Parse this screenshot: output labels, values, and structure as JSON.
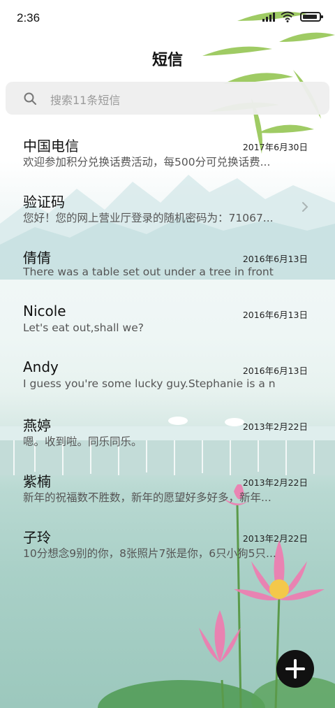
{
  "status_bar": {
    "time": "2:36"
  },
  "header": {
    "title": "短信"
  },
  "search": {
    "placeholder": "搜索11条短信"
  },
  "messages": [
    {
      "name": "中国电信",
      "date": "2017年6月30日",
      "preview": "欢迎参加积分兑换话费活动，每500分可兑换话费...",
      "chevron": false
    },
    {
      "name": "验证码",
      "date": "",
      "preview": "您好！您的网上营业厅登录的随机密码为：71067...",
      "chevron": true
    },
    {
      "name": "倩倩",
      "date": "2016年6月13日",
      "preview": "There was a table set out under a tree in front o...",
      "chevron": false
    },
    {
      "name": "Nicole",
      "date": "2016年6月13日",
      "preview": "Let's eat out,shall we?",
      "chevron": false
    },
    {
      "name": "Andy",
      "date": "2016年6月13日",
      "preview": "I guess you're some lucky guy.Stephanie is a n...",
      "chevron": false
    },
    {
      "name": "燕婷",
      "date": "2013年2月22日",
      "preview": "嗯。收到啦。同乐同乐。",
      "chevron": false
    },
    {
      "name": "紫楠",
      "date": "2013年2月22日",
      "preview": "新年的祝福数不胜数，新年的愿望好多好多，新年...",
      "chevron": false
    },
    {
      "name": "子玲",
      "date": "2013年2月22日",
      "preview": "10分想念9别的你，8张照片7张是你，6只小狗5只...",
      "chevron": false
    }
  ],
  "icons": {
    "search": "search-icon",
    "chevron": "chevron-right-icon",
    "compose": "plus-icon",
    "signal": "signal-icon",
    "wifi": "wifi-icon",
    "battery": "battery-icon"
  },
  "colors": {
    "fab": "#111111",
    "search_bg": "#eeeeee",
    "text_primary": "#111111",
    "text_secondary": "#555555"
  }
}
